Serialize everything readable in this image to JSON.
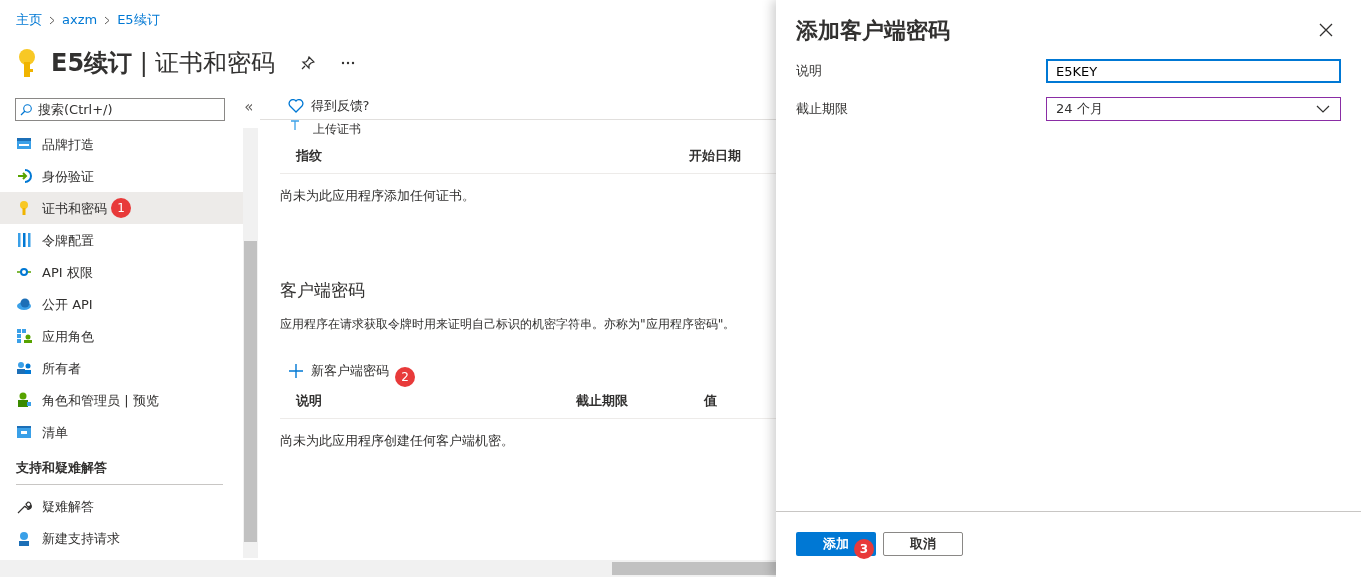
{
  "breadcrumb": [
    "主页",
    "axzm",
    "E5续订"
  ],
  "title": "**E5续订** | 证书和密码",
  "search": {
    "placeholder": "搜索(Ctrl+/)"
  },
  "collapse": "«",
  "sidebar": {
    "items": [
      {
        "label": "品牌打造",
        "selected": false
      },
      {
        "label": "身份验证",
        "selected": false
      },
      {
        "label": "证书和密码",
        "selected": true,
        "badge": "1"
      },
      {
        "label": "令牌配置",
        "selected": false
      },
      {
        "label": "API 权限",
        "selected": false
      },
      {
        "label": "公开 API",
        "selected": false
      },
      {
        "label": "应用角色",
        "selected": false
      },
      {
        "label": "所有者",
        "selected": false
      },
      {
        "label": "角色和管理员 | 预览",
        "selected": false
      },
      {
        "label": "清单",
        "selected": false
      }
    ],
    "sections": [
      {
        "heading": "支持和疑难解答",
        "items": [
          {
            "label": "疑难解答",
            "selected": false
          },
          {
            "label": "新建支持请求",
            "selected": false
          }
        ]
      }
    ]
  },
  "main": {
    "feedback": "得到反馈?",
    "upload": "上传证书",
    "certificates": {
      "columns": [
        "指纹",
        "开始日期"
      ],
      "empty": "尚未为此应用程序添加任何证书。"
    },
    "secrets": {
      "heading": "客户端密码",
      "description": "应用程序在请求获取令牌时用来证明自己标识的机密字符串。亦称为\"应用程序密码\"。",
      "new_button": {
        "label": "新客户端密码",
        "badge": "2"
      },
      "columns": [
        "说明",
        "截止期限",
        "值"
      ],
      "empty": "尚未为此应用程序创建任何客户端机密。"
    }
  },
  "panel": {
    "title": "添加客户端密码",
    "fields": [
      {
        "kind": "text",
        "label": "说明",
        "value": "E5KEY",
        "focused": true
      },
      {
        "kind": "select",
        "label": "截止期限",
        "value": "24 个月",
        "focused": false
      }
    ],
    "buttons": [
      {
        "kind": "primary",
        "label": "添加",
        "badge": "3"
      },
      {
        "kind": "secondary",
        "label": "取消"
      }
    ]
  }
}
